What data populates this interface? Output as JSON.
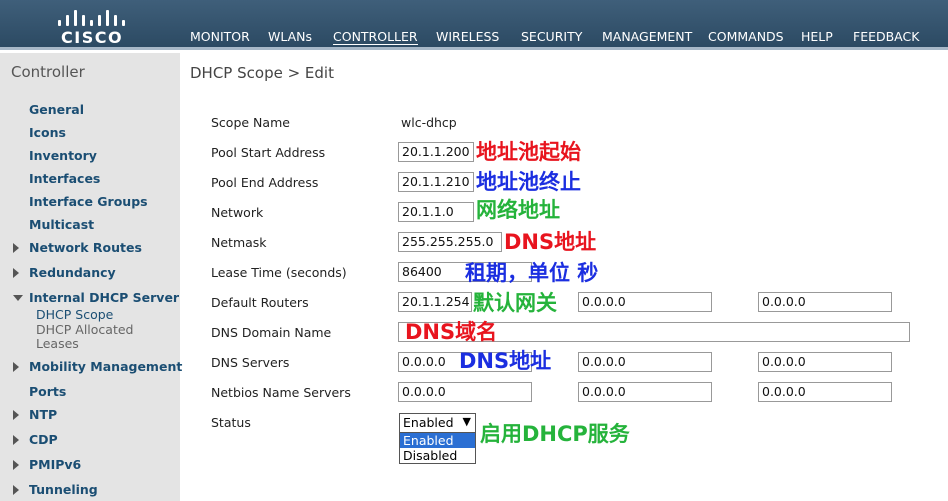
{
  "brand": "CISCO",
  "nav": [
    "MONITOR",
    "WLANs",
    "CONTROLLER",
    "WIRELESS",
    "SECURITY",
    "MANAGEMENT",
    "COMMANDS",
    "HELP",
    "FEEDBACK"
  ],
  "active_nav": "CONTROLLER",
  "sidebar": {
    "title": "Controller",
    "items": [
      {
        "label": "General"
      },
      {
        "label": "Icons"
      },
      {
        "label": "Inventory"
      },
      {
        "label": "Interfaces"
      },
      {
        "label": "Interface Groups"
      },
      {
        "label": "Multicast"
      },
      {
        "label": "Network Routes"
      },
      {
        "label": "Redundancy"
      },
      {
        "label": "Internal DHCP Server"
      },
      {
        "label": "Mobility Management"
      },
      {
        "label": "Ports"
      },
      {
        "label": "NTP"
      },
      {
        "label": "CDP"
      },
      {
        "label": "PMIPv6"
      },
      {
        "label": "Tunneling"
      }
    ],
    "subitems": [
      {
        "label": "DHCP Scope"
      },
      {
        "label": "DHCP Allocated"
      },
      {
        "label": "Leases"
      }
    ]
  },
  "page_title": "DHCP Scope > Edit",
  "form": {
    "scope_name_label": "Scope Name",
    "scope_name_value": "wlc-dhcp",
    "pool_start_label": "Pool Start Address",
    "pool_start_value": "20.1.1.200",
    "pool_end_label": "Pool End Address",
    "pool_end_value": "20.1.1.210",
    "network_label": "Network",
    "network_value": "20.1.1.0",
    "netmask_label": "Netmask",
    "netmask_value": "255.255.255.0",
    "lease_label": "Lease Time (seconds)",
    "lease_value": "86400",
    "routers_label": "Default Routers",
    "routers_values": [
      "20.1.1.254",
      "0.0.0.0",
      "0.0.0.0"
    ],
    "domain_label": "DNS Domain Name",
    "domain_value": "",
    "dns_label": "DNS Servers",
    "dns_values": [
      "0.0.0.0",
      "0.0.0.0",
      "0.0.0.0"
    ],
    "netbios_label": "Netbios Name Servers",
    "netbios_values": [
      "0.0.0.0",
      "0.0.0.0",
      "0.0.0.0"
    ],
    "status_label": "Status",
    "status_value": "Enabled",
    "status_options": [
      "Enabled",
      "Disabled"
    ]
  },
  "annotations": {
    "pool_start": "地址池起始",
    "pool_end": "地址池终止",
    "network": "网络地址",
    "netmask": "DNS地址",
    "lease": "租期，单位 秒",
    "routers": "默认网关",
    "domain": "DNS域名",
    "dns": "DNS地址",
    "status": "启用DHCP服务"
  },
  "colors": {
    "header_bg": "#34536d",
    "sidebar_bg": "#e4e4e4",
    "link": "#1b4e73",
    "annotation_red": "#e8141e",
    "annotation_blue": "#1b2ee0",
    "annotation_green": "#25b33b"
  }
}
